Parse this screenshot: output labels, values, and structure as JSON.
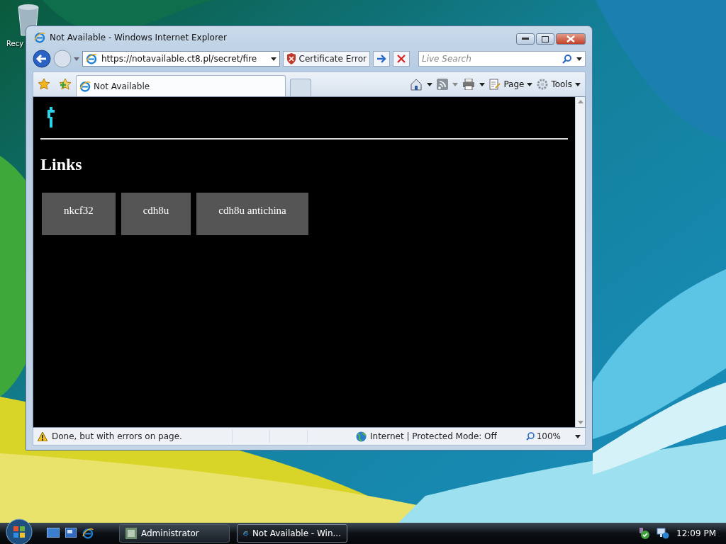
{
  "desktop": {
    "icons": [
      {
        "label": "Recy"
      }
    ]
  },
  "window": {
    "title": "Not Available - Windows Internet Explorer",
    "address": "https://notavailable.ct8.pl/secret/fire",
    "certificate_error": "Certificate Error",
    "search": {
      "placeholder": "Live Search"
    },
    "tabs": [
      {
        "label": "Not Available",
        "selected": true
      }
    ],
    "toolbar": {
      "page": "Page",
      "tools": "Tools"
    },
    "content": {
      "heading": "Links",
      "links": [
        "nkcf32",
        "cdh8u",
        "cdh8u antichina"
      ]
    },
    "status_bar": {
      "message": "Done, but with errors on page.",
      "zone": "Internet | Protected Mode: Off",
      "zoom": "100%"
    }
  },
  "taskbar": {
    "buttons": [
      {
        "label": "Administrator",
        "selected": false,
        "kind": "console"
      },
      {
        "label": "Not Available - Win...",
        "selected": true,
        "kind": "browser"
      }
    ],
    "clock": "12:09 PM"
  }
}
